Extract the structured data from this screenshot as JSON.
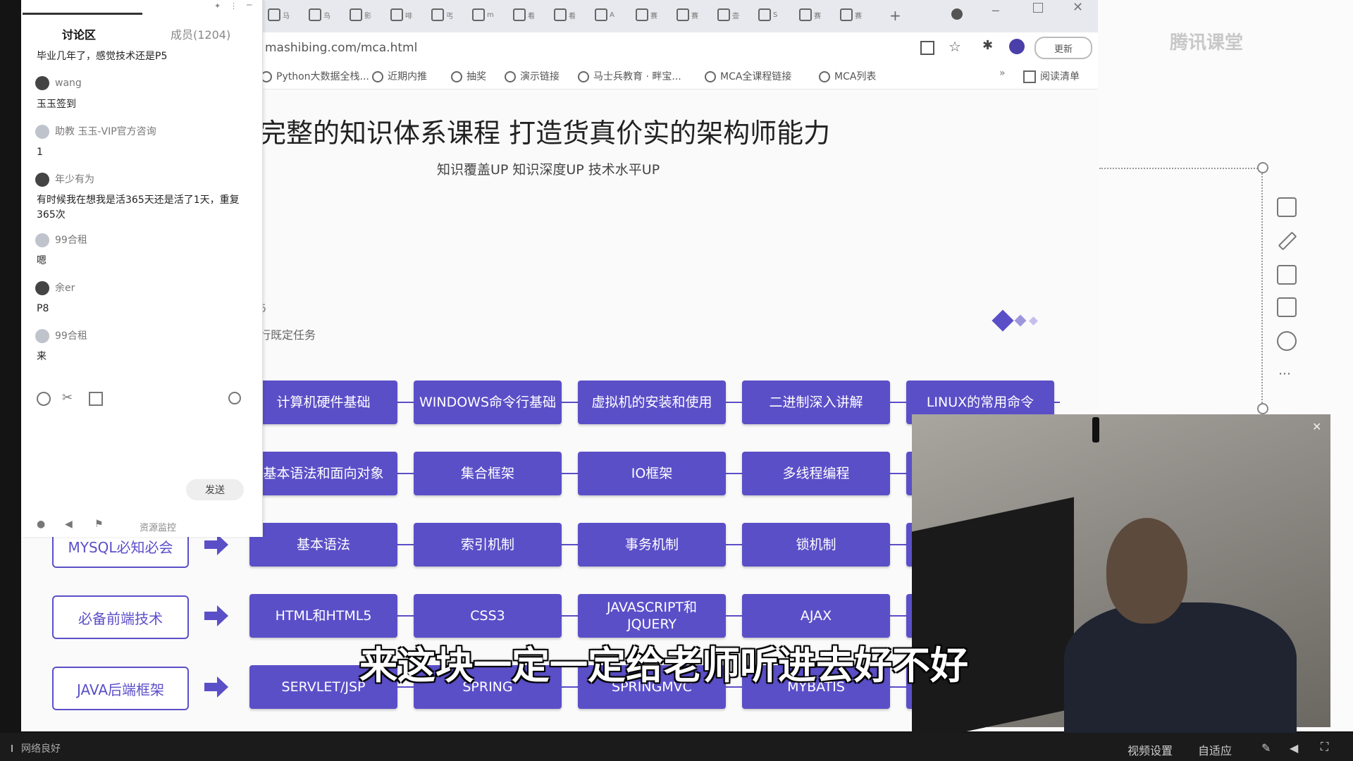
{
  "browser": {
    "url": "mashibing.com/mca.html",
    "update_button": "更新",
    "tab_glyphs": [
      "马",
      "鸟",
      "影",
      "啡",
      "丐",
      "m",
      "看",
      "看",
      "A",
      "赛",
      "赛",
      "壶",
      "S",
      "赛",
      "赛"
    ],
    "bookmarks": [
      "Python大数据全栈...",
      "近期内推",
      "抽奖",
      "演示链接",
      "马士兵教育 · 畔宝...",
      "MCA全课程链接",
      "MCA列表"
    ],
    "reading_list": "阅读清单",
    "more": "»"
  },
  "page": {
    "heading": "完整的知识体系课程 打造货真价实的架构师能力",
    "subheading": "知识覆盖UP 知识深度UP 技术水平UP",
    "partial_line1": "5",
    "partial_line2": "行既定任务"
  },
  "course_rows": [
    {
      "category": "",
      "items": [
        "计算机硬件基础",
        "WINDOWS命令行基础",
        "虚拟机的安装和使用",
        "二进制深入讲解",
        "LINUX的常用命令"
      ]
    },
    {
      "category": "",
      "items": [
        "基本语法和面向对象",
        "集合框架",
        "IO框架",
        "多线程编程",
        ""
      ]
    },
    {
      "category": "MYSQL必知必会",
      "items": [
        "基本语法",
        "索引机制",
        "事务机制",
        "锁机制",
        ""
      ]
    },
    {
      "category": "必备前端技术",
      "items": [
        "HTML和HTML5",
        "CSS3",
        "JAVASCRIPT和\nJQUERY",
        "AJAX",
        ""
      ]
    },
    {
      "category": "JAVA后端框架",
      "items": [
        "SERVLET/JSP",
        "SPRING",
        "SPRINGMVC",
        "MYBATIS",
        ""
      ]
    }
  ],
  "chat": {
    "title": "讨论区",
    "members": "成员(1204)",
    "messages": [
      {
        "user": "",
        "text": "毕业几年了，感觉技术还是P5"
      },
      {
        "user": "wang",
        "text": "玉玉签到"
      },
      {
        "user": "助教 玉玉-VIP官方咨询",
        "text": "1"
      },
      {
        "user": "年少有为",
        "text": "有时候我在想我是活365天还是活了1天，重复365次"
      },
      {
        "user": "99合租",
        "text": "嗯"
      },
      {
        "user": "余er",
        "text": "P8"
      },
      {
        "user": "99合租",
        "text": "来"
      }
    ],
    "send": "发送",
    "resource_monitor": "资源监控"
  },
  "overlay": {
    "caption": "来这块一定一定给老师听进去好不好",
    "watermark": "腾讯课堂"
  },
  "status": {
    "network": "网络良好",
    "video_settings": "视频设置",
    "adaptive": "自适应"
  },
  "colors": {
    "accent": "#5b4fc8",
    "chat_bg": "#ffffff",
    "status_bar": "#1b1b1b"
  }
}
